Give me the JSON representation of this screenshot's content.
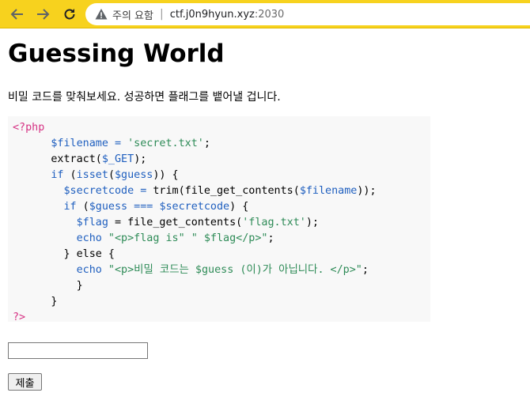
{
  "browser": {
    "security_label": "주의 요함",
    "url_host": "ctf.j0n9hyun.xyz",
    "url_port": ":2030"
  },
  "page": {
    "title": "Guessing World",
    "intro": "비밀 코드를 맞춰보세요. 성공하면 플래그를 뱉어낼 겁니다."
  },
  "code": {
    "open_tag": "<?php",
    "l1_var": "$filename",
    "l1_eq": " = ",
    "l1_str": "'secret.txt'",
    "l1_end": ";",
    "l2_fn": "extract(",
    "l2_var": "$_GET",
    "l2_end": ");",
    "l3_kw": "if",
    "l3_a": " (",
    "l3_fn": "isset",
    "l3_b": "(",
    "l3_var": "$guess",
    "l3_end": ")) {",
    "l4_var": "$secretcode",
    "l4_eq": " = ",
    "l4_fn": "trim(file_get_contents(",
    "l4_var2": "$filename",
    "l4_end": "));",
    "l5_kw": "if",
    "l5_a": " (",
    "l5_var": "$guess",
    "l5_op": " === ",
    "l5_var2": "$secretcode",
    "l5_end": ") {",
    "l6_var": "$flag",
    "l6_eq": " = ",
    "l6_fn": "file_get_contents(",
    "l6_str": "'flag.txt'",
    "l6_end": ");",
    "l7_kw": "echo",
    "l7_str": " \"<p>flag is\" \" $flag</p>\"",
    "l7_end": ";",
    "l8": "} else {",
    "l9_kw": "echo",
    "l9_str": " \"<p>비밀 코드는 $guess (이)가 아닙니다. </p>\"",
    "l9_end": ";",
    "l10": "}",
    "l11": "}",
    "close_tag": "?>"
  },
  "form": {
    "input_value": "",
    "submit_label": "제출"
  },
  "colors": {
    "toolbar": "#f7d21e",
    "code_bg": "#f8f8f8",
    "php_tag": "#d63384",
    "variable": "#1f5fbf",
    "string": "#2e8b57"
  },
  "icons": [
    "back-arrow-icon",
    "forward-arrow-icon",
    "reload-icon",
    "warning-icon"
  ]
}
